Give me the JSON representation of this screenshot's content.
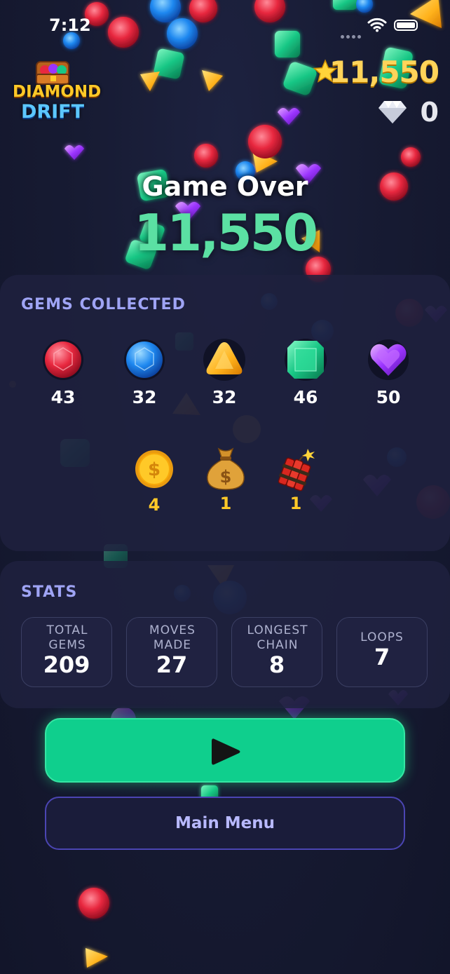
{
  "status_bar": {
    "time": "7:12"
  },
  "game": {
    "logo_line1": "DIAMOND",
    "logo_line2": "DRIFT"
  },
  "hud": {
    "score": "11,550",
    "diamonds": "0"
  },
  "result": {
    "title": "Game Over",
    "score": "11,550"
  },
  "gems_collected": {
    "title": "GEMS COLLECTED",
    "gems": [
      {
        "name": "ruby",
        "icon": "red-gem-icon",
        "color": "#e8283f",
        "count": "43"
      },
      {
        "name": "sapphire",
        "icon": "blue-gem-icon",
        "color": "#1e88f0",
        "count": "32"
      },
      {
        "name": "topaz",
        "icon": "yellow-triangle-gem-icon",
        "color": "#ffb21c",
        "count": "32"
      },
      {
        "name": "emerald",
        "icon": "green-gem-icon",
        "color": "#18c785",
        "count": "46"
      },
      {
        "name": "amethyst",
        "icon": "purple-heart-gem-icon",
        "color": "#9b34ff",
        "count": "50"
      }
    ],
    "items": [
      {
        "name": "coin",
        "icon": "gold-coin-icon",
        "count": "4"
      },
      {
        "name": "money-bag",
        "icon": "money-bag-icon",
        "count": "1"
      },
      {
        "name": "dynamite",
        "icon": "dynamite-icon",
        "count": "1"
      }
    ]
  },
  "stats": {
    "title": "STATS",
    "items": [
      {
        "label": "TOTAL GEMS",
        "value": "209"
      },
      {
        "label": "MOVES MADE",
        "value": "27"
      },
      {
        "label": "LONGEST CHAIN",
        "value": "8"
      },
      {
        "label": "LOOPS",
        "value": "7"
      }
    ]
  },
  "buttons": {
    "play_icon": "play-icon",
    "menu_label": "Main Menu"
  },
  "colors": {
    "accent_green": "#0fcf8d",
    "score_green": "#5be0a3",
    "gold": "#ffc928",
    "section_title": "#9fa4f5",
    "menu_border": "#4b45b3"
  }
}
